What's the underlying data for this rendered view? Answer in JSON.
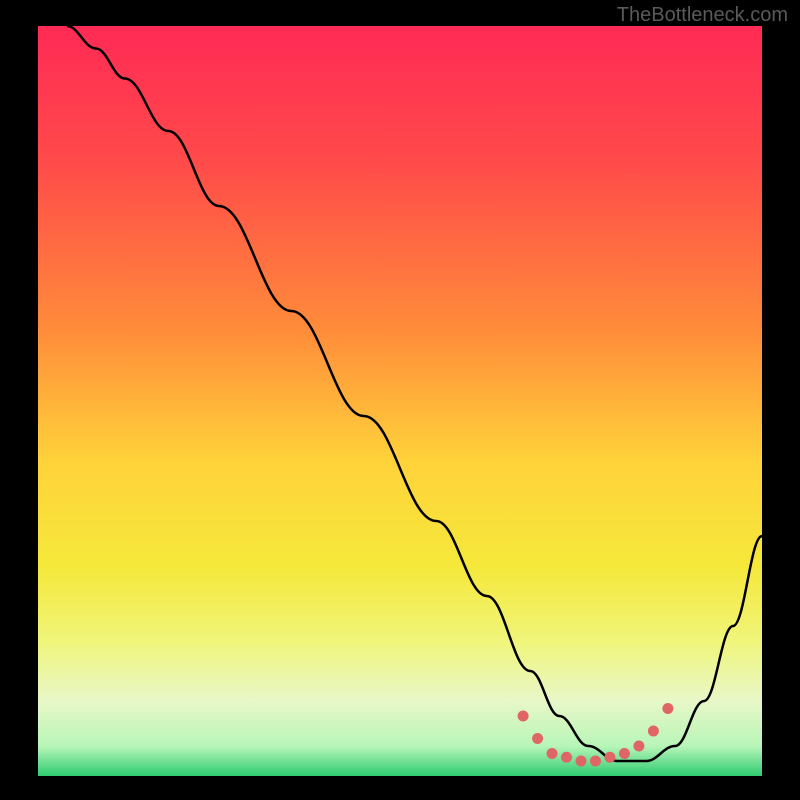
{
  "watermark": "TheBottleneck.com",
  "chart_data": {
    "type": "line",
    "title": "",
    "xlabel": "",
    "ylabel": "",
    "xlim": [
      0,
      100
    ],
    "ylim": [
      0,
      100
    ],
    "gradient_stops": [
      {
        "offset": 0,
        "color": "#ff2a55"
      },
      {
        "offset": 18,
        "color": "#ff4a4a"
      },
      {
        "offset": 40,
        "color": "#ff8a3a"
      },
      {
        "offset": 58,
        "color": "#ffd23a"
      },
      {
        "offset": 72,
        "color": "#f5e83a"
      },
      {
        "offset": 82,
        "color": "#f0f57a"
      },
      {
        "offset": 90,
        "color": "#e8f7c8"
      },
      {
        "offset": 96,
        "color": "#b8f5b8"
      },
      {
        "offset": 100,
        "color": "#2ecc71"
      }
    ],
    "series": [
      {
        "name": "curve",
        "color": "#000000",
        "x": [
          4,
          8,
          12,
          18,
          25,
          35,
          45,
          55,
          62,
          68,
          72,
          76,
          80,
          84,
          88,
          92,
          96,
          100
        ],
        "y": [
          100,
          97,
          93,
          86,
          76,
          62,
          48,
          34,
          24,
          14,
          8,
          4,
          2,
          2,
          4,
          10,
          20,
          32
        ]
      }
    ],
    "markers": {
      "name": "bottom-dots",
      "color": "#e06666",
      "x": [
        67,
        69,
        71,
        73,
        75,
        77,
        79,
        81,
        83,
        85,
        87
      ],
      "y": [
        8,
        5,
        3,
        2.5,
        2,
        2,
        2.5,
        3,
        4,
        6,
        9
      ]
    }
  }
}
